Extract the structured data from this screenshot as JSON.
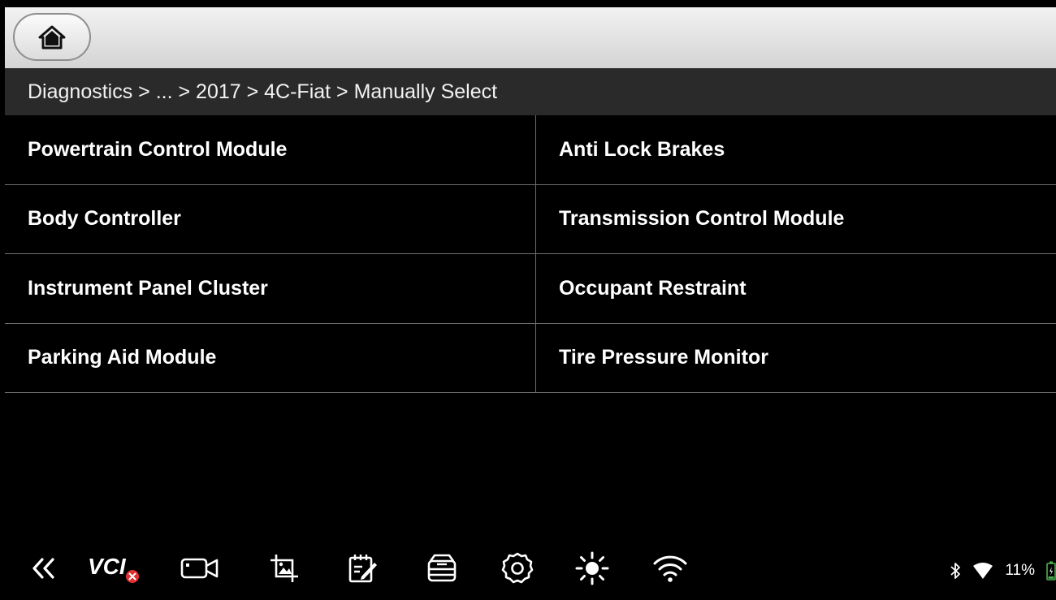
{
  "header": {
    "home_icon": "home-icon"
  },
  "breadcrumb": {
    "path": "Diagnostics >  ... > 2017 > 4C-Fiat > Manually Select"
  },
  "modules": [
    "Powertrain Control Module",
    "Anti Lock Brakes",
    "Body Controller",
    "Transmission Control Module",
    "Instrument Panel Cluster",
    "Occupant Restraint",
    "Parking Aid Module",
    "Tire Pressure Monitor"
  ],
  "toolbar": {
    "items": [
      {
        "icon": "double-chevron-left-icon"
      },
      {
        "icon": "vci-disconnected-icon",
        "label": "VCI"
      },
      {
        "icon": "video-camera-icon"
      },
      {
        "icon": "screenshot-crop-icon"
      },
      {
        "icon": "notes-edit-icon"
      },
      {
        "icon": "data-storage-icon"
      },
      {
        "icon": "settings-gear-icon"
      },
      {
        "icon": "brightness-icon"
      },
      {
        "icon": "wifi-icon"
      }
    ]
  },
  "status_bar": {
    "bluetooth_icon": "bluetooth-icon",
    "wifi_signal_icon": "wifi-signal-icon",
    "battery_percent": "11%",
    "battery_icon": "battery-charging-icon"
  },
  "colors": {
    "background": "#000000",
    "header_bg": "#e6e6e6",
    "breadcrumb_bg": "#2a2a2a",
    "divider": "#6f6f6f",
    "vci_error_red": "#e03030",
    "battery_green": "#4caf50"
  }
}
